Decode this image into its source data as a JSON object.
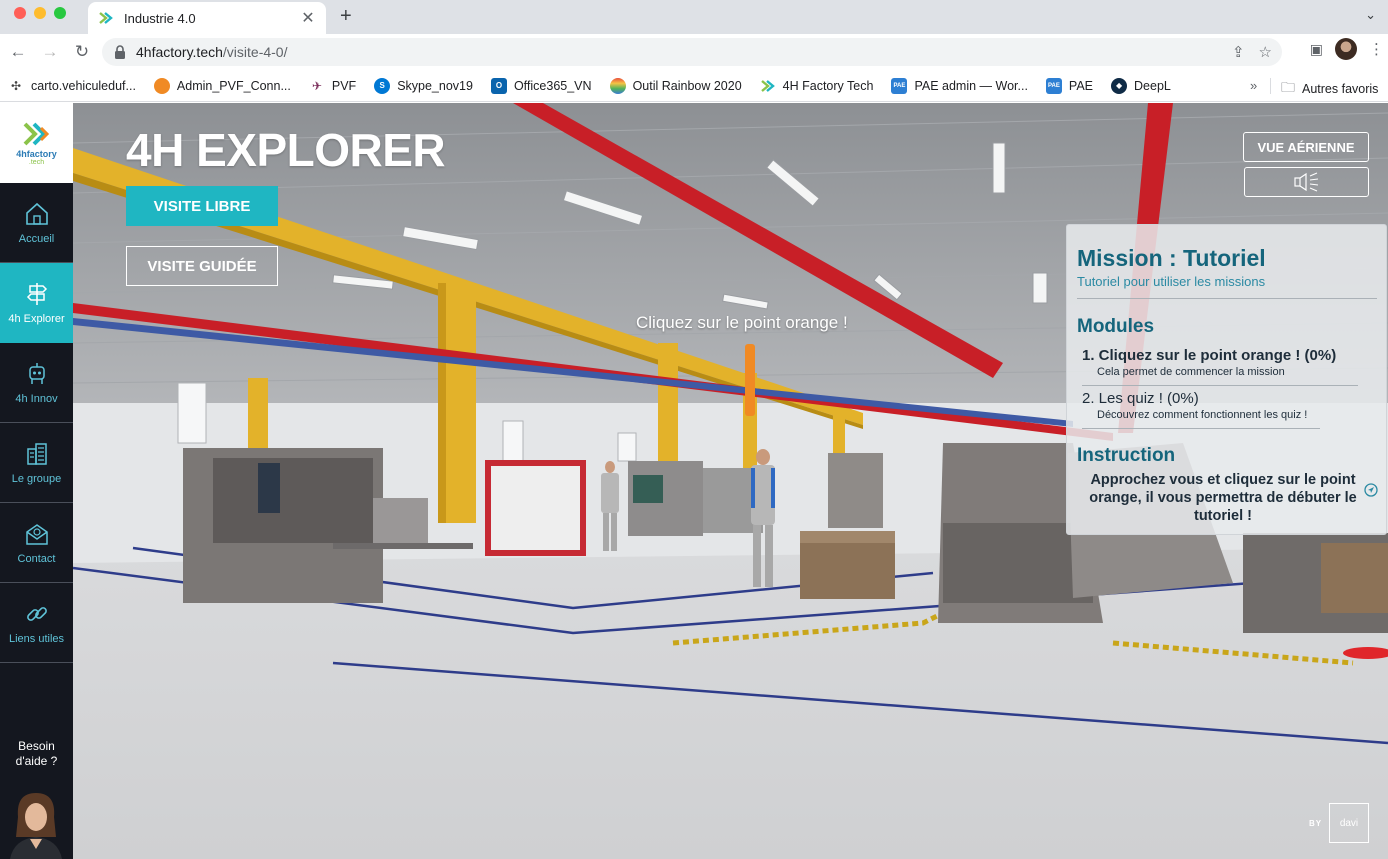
{
  "browser": {
    "tab_title": "Industrie 4.0",
    "url_host": "4hfactory.tech",
    "url_path": "/visite-4-0/",
    "bookmarks": [
      "carto.vehiculeduf...",
      "Admin_PVF_Conn...",
      "PVF",
      "Skype_nov19",
      "Office365_VN",
      "Outil Rainbow 2020",
      "4H Factory Tech",
      "PAE admin — Wor...",
      "PAE",
      "DeepL"
    ],
    "bookmarks_more": "»",
    "other_bookmarks": "Autres favoris"
  },
  "sidebar": {
    "logo_text": "4hfactory",
    "logo_sub": ".tech",
    "items": [
      {
        "label": "Accueil",
        "icon": "home-icon"
      },
      {
        "label": "4h Explorer",
        "icon": "signpost-icon"
      },
      {
        "label": "4h Innov",
        "icon": "robot-icon"
      },
      {
        "label": "Le groupe",
        "icon": "building-icon"
      },
      {
        "label": "Contact",
        "icon": "mail-icon"
      },
      {
        "label": "Liens utiles",
        "icon": "link-icon"
      }
    ],
    "active_index": 1,
    "help_line1": "Besoin",
    "help_line2": "d'aide ?"
  },
  "scene": {
    "title": "4H EXPLORER",
    "btn_libre": "VISITE LIBRE",
    "btn_guidee": "VISITE GUIDÉE",
    "btn_aerial": "VUE AÉRIENNE",
    "hint": "Cliquez sur le point orange !",
    "by_label": "BY",
    "davi_text": "davi"
  },
  "mission": {
    "title": "Mission : Tutoriel",
    "subtitle": "Tutoriel pour utiliser les missions",
    "modules_heading": "Modules",
    "modules": [
      {
        "title": "1. Cliquez sur le point orange ! (0%)",
        "desc": "Cela permet de commencer la mission",
        "progress": 0
      },
      {
        "title": "2. Les quiz ! (0%)",
        "desc": "Découvrez comment fonctionnent les quiz !",
        "progress": 0
      }
    ],
    "instruction_heading": "Instruction",
    "instruction_text": "Approchez vous et cliquez sur le point orange, il vous permettra de débuter le tutoriel !"
  },
  "colors": {
    "accent": "#1fb6c2",
    "sidebar_bg": "#14171f",
    "mission_heading": "#15657c",
    "marker": "#f08a24"
  }
}
